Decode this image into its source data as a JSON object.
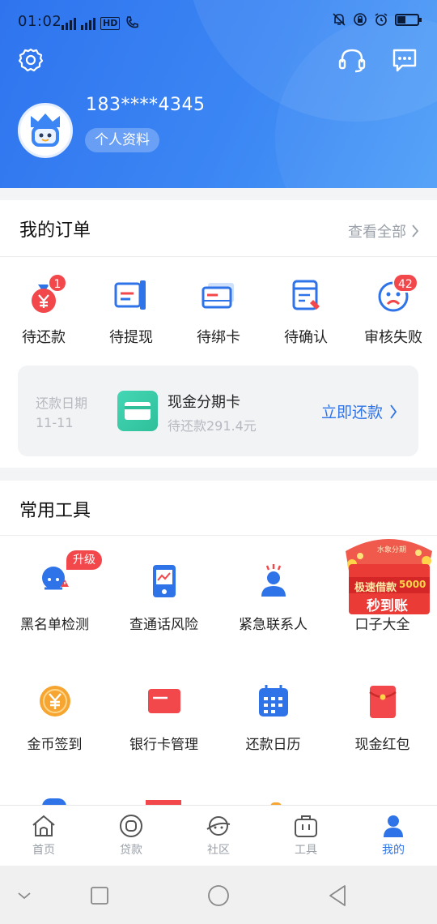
{
  "status_bar": {
    "time": "01:02",
    "network_label": "HD"
  },
  "profile": {
    "phone": "183****4345",
    "profile_label": "个人资料"
  },
  "orders": {
    "title": "我的订单",
    "view_all": "查看全部",
    "items": [
      {
        "label": "待还款",
        "icon": "money-bag-icon",
        "badge": "1"
      },
      {
        "label": "待提现",
        "icon": "withdraw-icon",
        "badge": ""
      },
      {
        "label": "待绑卡",
        "icon": "bind-card-icon",
        "badge": ""
      },
      {
        "label": "待确认",
        "icon": "confirm-icon",
        "badge": ""
      },
      {
        "label": "审核失败",
        "icon": "sad-face-icon",
        "badge": "42"
      }
    ],
    "repayment": {
      "date_label": "还款日期",
      "date": "11-11",
      "card_icon_text": "分期卡",
      "card_name": "现金分期卡",
      "amount_text": "待还款291.4元",
      "action": "立即还款"
    }
  },
  "tools": {
    "title": "常用工具",
    "upgrade_badge": "升级",
    "items": [
      {
        "label": "黑名单检测",
        "icon": "blacklist-check-icon"
      },
      {
        "label": "查通话风险",
        "icon": "call-risk-icon"
      },
      {
        "label": "紧急联系人",
        "icon": "emergency-contact-icon"
      },
      {
        "label": "口子大全",
        "icon": "promo-icon"
      },
      {
        "label": "金币签到",
        "icon": "coin-checkin-icon"
      },
      {
        "label": "银行卡管理",
        "icon": "bank-card-icon"
      },
      {
        "label": "还款日历",
        "icon": "calendar-icon"
      },
      {
        "label": "现金红包",
        "icon": "red-envelope-icon"
      }
    ],
    "promo": {
      "brand": "水象分期",
      "line1": "极速借款",
      "amount": "5000",
      "line2": "秒到账"
    }
  },
  "tabbar": {
    "items": [
      {
        "label": "首页",
        "icon": "home-icon",
        "active": false
      },
      {
        "label": "贷款",
        "icon": "loan-icon",
        "active": false
      },
      {
        "label": "社区",
        "icon": "community-icon",
        "active": false
      },
      {
        "label": "工具",
        "icon": "toolbox-icon",
        "active": false
      },
      {
        "label": "我的",
        "icon": "profile-icon",
        "active": true
      }
    ]
  },
  "colors": {
    "primary": "#2f73e8",
    "header_blue": "#3b86f4",
    "badge_red": "#f2474b",
    "text": "#222222",
    "muted": "#9aa0a8"
  }
}
